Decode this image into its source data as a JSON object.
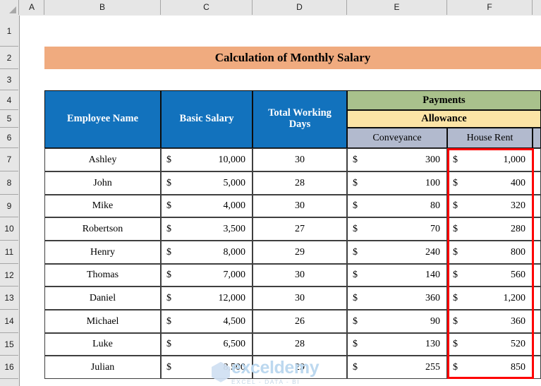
{
  "spreadsheet": {
    "column_headers": [
      "A",
      "B",
      "C",
      "D",
      "E",
      "F"
    ],
    "row_headers": [
      "1",
      "2",
      "3",
      "4",
      "5",
      "6",
      "7",
      "8",
      "9",
      "10",
      "11",
      "12",
      "13",
      "14",
      "15",
      "16"
    ],
    "title": "Calculation of Monthly Salary",
    "headers": {
      "employee_name": "Employee Name",
      "basic_salary": "Basic Salary",
      "total_working_days": "Total Working Days",
      "payments": "Payments",
      "allowance": "Allowance",
      "conveyance": "Conveyance",
      "house_rent": "House Rent"
    },
    "currency_symbol": "$",
    "rows": [
      {
        "row": "7",
        "name": "Ashley",
        "basic_salary": "10,000",
        "working_days": "30",
        "conveyance": "300",
        "house_rent": "1,000"
      },
      {
        "row": "8",
        "name": "John",
        "basic_salary": "5,000",
        "working_days": "28",
        "conveyance": "100",
        "house_rent": "400"
      },
      {
        "row": "9",
        "name": "Mike",
        "basic_salary": "4,000",
        "working_days": "30",
        "conveyance": "80",
        "house_rent": "320"
      },
      {
        "row": "10",
        "name": "Robertson",
        "basic_salary": "3,500",
        "working_days": "27",
        "conveyance": "70",
        "house_rent": "280"
      },
      {
        "row": "11",
        "name": "Henry",
        "basic_salary": "8,000",
        "working_days": "29",
        "conveyance": "240",
        "house_rent": "800"
      },
      {
        "row": "12",
        "name": "Thomas",
        "basic_salary": "7,000",
        "working_days": "30",
        "conveyance": "140",
        "house_rent": "560"
      },
      {
        "row": "13",
        "name": "Daniel",
        "basic_salary": "12,000",
        "working_days": "30",
        "conveyance": "360",
        "house_rent": "1,200"
      },
      {
        "row": "14",
        "name": "Michael",
        "basic_salary": "4,500",
        "working_days": "26",
        "conveyance": "90",
        "house_rent": "360"
      },
      {
        "row": "15",
        "name": "Luke",
        "basic_salary": "6,500",
        "working_days": "28",
        "conveyance": "130",
        "house_rent": "520"
      },
      {
        "row": "16",
        "name": "Julian",
        "basic_salary": "8,500",
        "working_days": "29",
        "conveyance": "255",
        "house_rent": "850"
      }
    ],
    "selection": {
      "range": "F7:F16",
      "color": "#fe0000"
    },
    "colors": {
      "title_banner": "#f0ab7f",
      "header_blue": "#1272bd",
      "header_green": "#a9c18c",
      "header_yellow": "#fce4a6",
      "header_gray": "#b2bace"
    }
  },
  "watermark": {
    "main": "exceldemy",
    "sub": "EXCEL - DATA - BI"
  }
}
